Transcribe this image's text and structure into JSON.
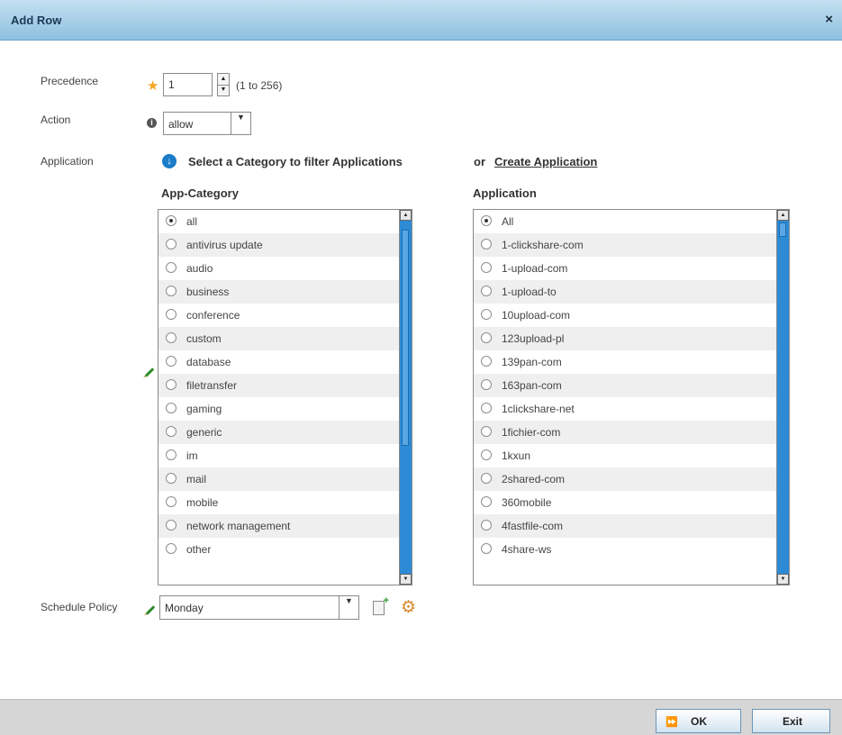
{
  "dialog": {
    "title": "Add Row",
    "close_symbol": "×"
  },
  "precedence": {
    "label": "Precedence",
    "value": "1",
    "range_hint": "(1 to 256)"
  },
  "action": {
    "label": "Action",
    "value": "allow"
  },
  "application": {
    "label": "Application",
    "filter_text": "Select a Category to filter Applications",
    "or_text": "or",
    "create_link": "Create Application"
  },
  "app_category": {
    "header": "App-Category",
    "selected": "all",
    "items": [
      "all",
      "antivirus update",
      "audio",
      "business",
      "conference",
      "custom",
      "database",
      "filetransfer",
      "gaming",
      "generic",
      "im",
      "mail",
      "mobile",
      "network management",
      "other"
    ]
  },
  "app_list": {
    "header": "Application",
    "selected": "All",
    "items": [
      "All",
      "1-clickshare-com",
      "1-upload-com",
      "1-upload-to",
      "10upload-com",
      "123upload-pl",
      "139pan-com",
      "163pan-com",
      "1clickshare-net",
      "1fichier-com",
      "1kxun",
      "2shared-com",
      "360mobile",
      "4fastfile-com",
      "4share-ws"
    ]
  },
  "schedule_policy": {
    "label": "Schedule Policy",
    "value": "Monday"
  },
  "buttons": {
    "ok": "OK",
    "exit": "Exit"
  }
}
